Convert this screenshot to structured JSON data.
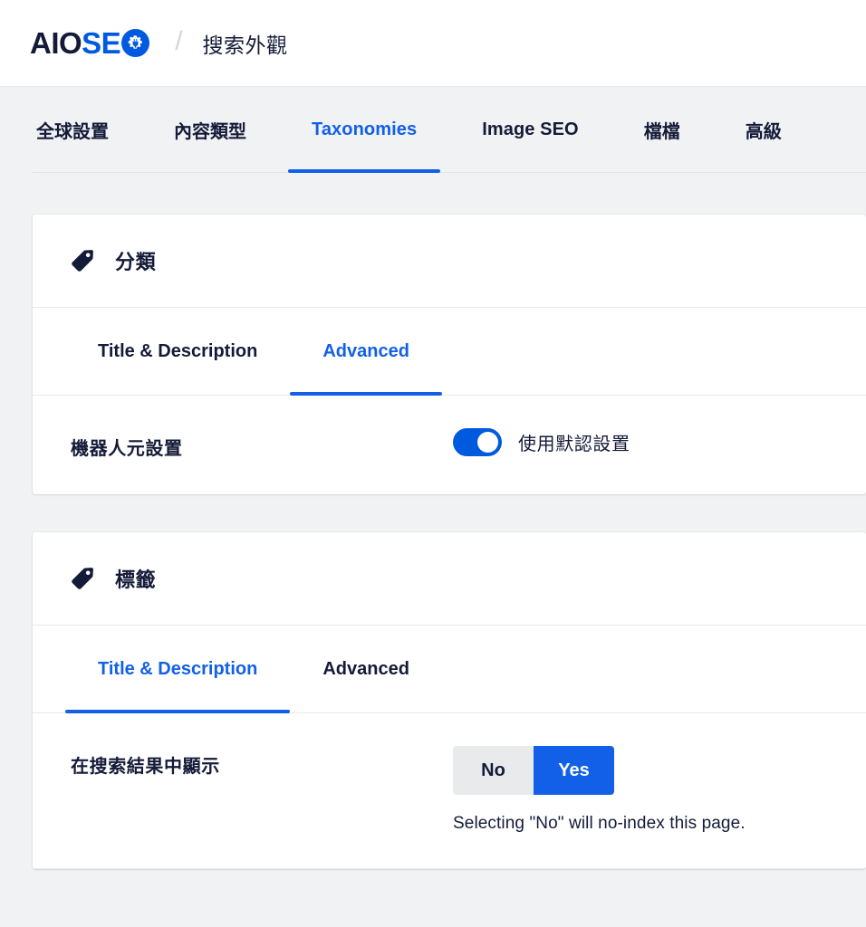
{
  "header": {
    "logo": {
      "part1": "AIO",
      "part2": "SE",
      "mark_icon": "gear-plug-icon"
    },
    "separator": "/",
    "breadcrumb_title": "搜索外觀"
  },
  "main_tabs": [
    {
      "label": "全球設置",
      "active": false,
      "latin": false
    },
    {
      "label": "內容類型",
      "active": false,
      "latin": false
    },
    {
      "label": "Taxonomies",
      "active": true,
      "latin": true
    },
    {
      "label": "Image SEO",
      "active": false,
      "latin": true
    },
    {
      "label": "檔檔",
      "active": false,
      "latin": false
    },
    {
      "label": "高級",
      "active": false,
      "latin": false
    }
  ],
  "cards": [
    {
      "icon": "tag-icon",
      "title": "分類",
      "tabs": [
        {
          "label": "Title & Description",
          "active": false
        },
        {
          "label": "Advanced",
          "active": true
        }
      ],
      "setting": {
        "label": "機器人元設置",
        "control": "toggle",
        "toggle_on": true,
        "toggle_label": "使用默認設置"
      }
    },
    {
      "icon": "tag-icon",
      "title": "標籤",
      "tabs": [
        {
          "label": "Title & Description",
          "active": true
        },
        {
          "label": "Advanced",
          "active": false
        }
      ],
      "setting": {
        "label": "在搜索結果中顯示",
        "control": "segmented",
        "options": [
          {
            "label": "No",
            "active": false
          },
          {
            "label": "Yes",
            "active": true
          }
        ],
        "help_text": "Selecting \"No\" will no-index this page."
      }
    }
  ],
  "colors": {
    "accent_blue": "#1260e8",
    "logo_blue": "#005ae0",
    "dark_navy": "#141b38",
    "page_bg": "#f1f2f4",
    "segment_off": "#e8eaec"
  }
}
